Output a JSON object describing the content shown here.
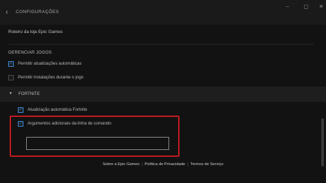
{
  "titlebar": {
    "title": "CONFIGURAÇÕES",
    "back_glyph": "‹",
    "minimize_glyph": "–",
    "maximize_glyph": "▢",
    "close_glyph": "✕"
  },
  "store_route": "Roteiro da loja Epic Games",
  "manage_games": {
    "title": "GERENCIAR JOGOS",
    "items": [
      {
        "label": "Permitir atualizações automáticas",
        "checked": true
      },
      {
        "label": "Permitir instalações durante o jogo",
        "checked": false
      }
    ]
  },
  "fortnite": {
    "label": "FORTNITE",
    "caret": "▼",
    "items": [
      {
        "label": "Atualização automática Fortnite",
        "checked": true
      },
      {
        "label": "Argumentos adicionais da linha de comando",
        "checked": true
      }
    ],
    "args_value": ""
  },
  "footer": {
    "about": "Sobre a Epic Games",
    "privacy": "Política de Privacidade",
    "terms": "Termos de Serviço",
    "separator": "|"
  },
  "colors": {
    "accent": "#3f8fde",
    "highlight": "#c31b22",
    "background": "#121212"
  },
  "icons": {
    "check": "✓"
  }
}
